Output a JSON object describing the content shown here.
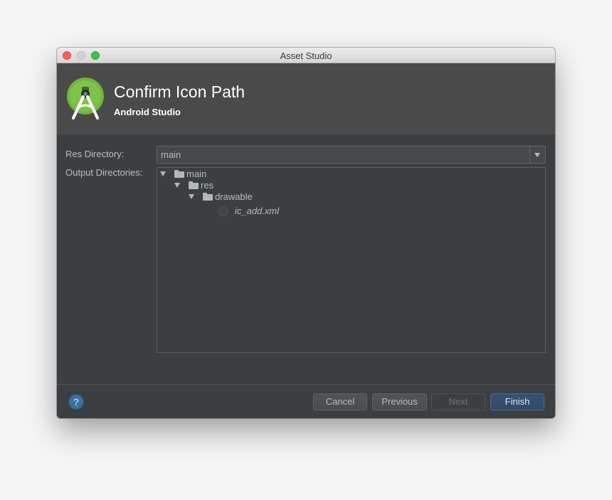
{
  "window": {
    "title": "Asset Studio",
    "traffic_lights": [
      "close",
      "minimize",
      "zoom"
    ]
  },
  "header": {
    "title": "Confirm Icon Path",
    "subtitle": "Android Studio",
    "logo_icon": "android-studio-logo-icon"
  },
  "form": {
    "res_directory_label": "Res Directory:",
    "res_directory_value": "main",
    "output_directories_label": "Output Directories:"
  },
  "tree": {
    "nodes": [
      {
        "label": "main",
        "type": "folder",
        "expanded": true,
        "depth": 0
      },
      {
        "label": "res",
        "type": "folder",
        "expanded": true,
        "depth": 1
      },
      {
        "label": "drawable",
        "type": "folder",
        "expanded": true,
        "depth": 2
      },
      {
        "label": "ic_add.xml",
        "type": "file",
        "depth": 3
      }
    ]
  },
  "footer": {
    "help_label": "?",
    "cancel_label": "Cancel",
    "previous_label": "Previous",
    "next_label": "Next",
    "finish_label": "Finish"
  },
  "colors": {
    "dialog_bg": "#3c3f41",
    "header_bg": "#4a4a4a",
    "text": "#bbbbbb",
    "finish_bg": "#365880",
    "close": "#fc5f57",
    "zoom": "#34c84a"
  }
}
